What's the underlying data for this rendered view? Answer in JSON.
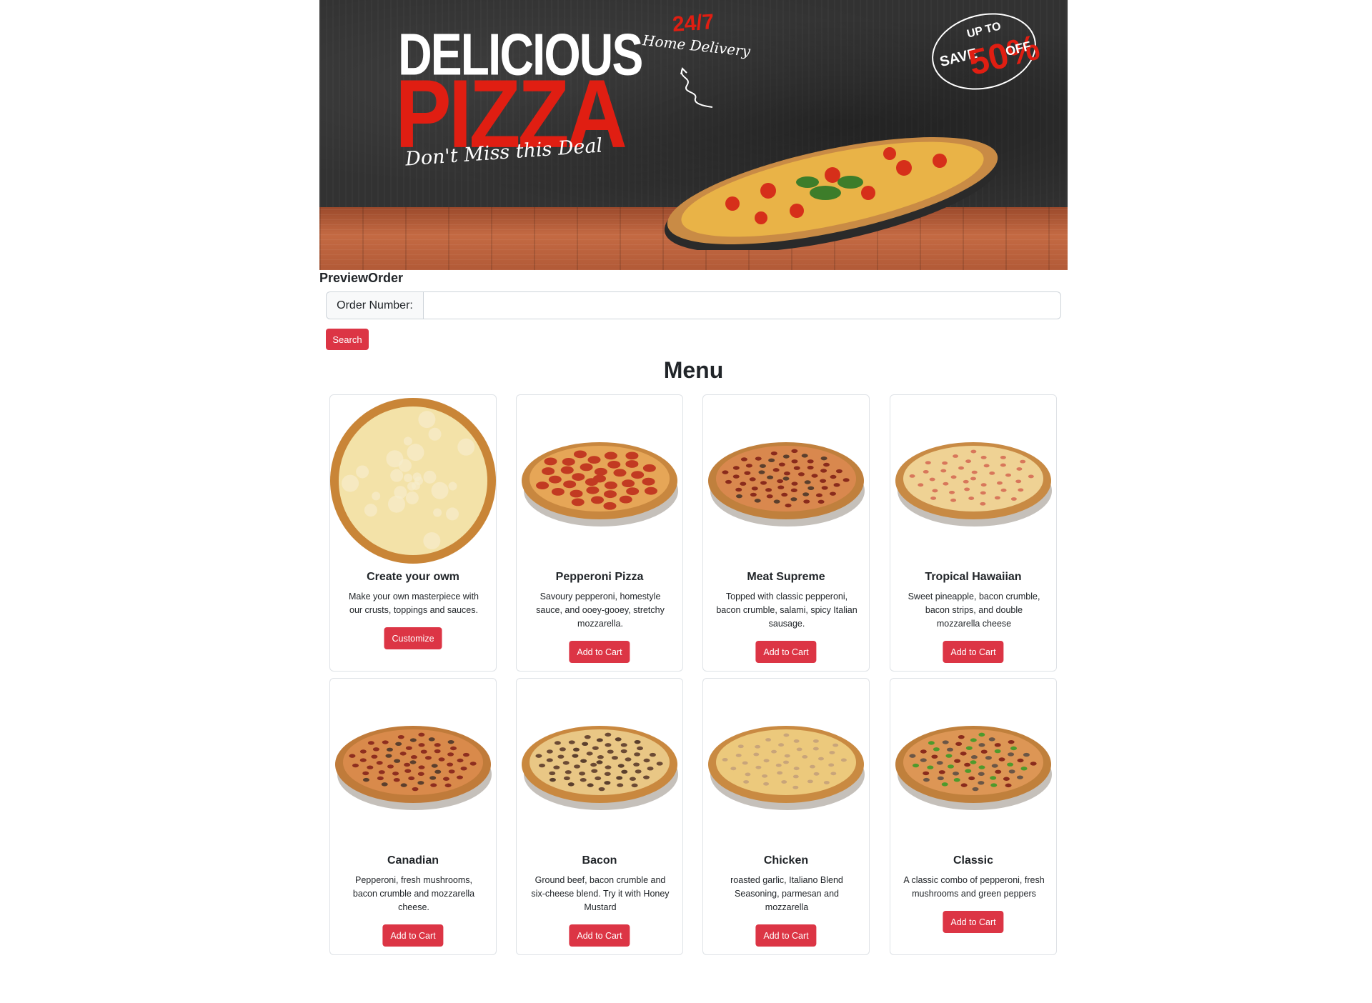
{
  "banner": {
    "headline_top": "DELICIOUS",
    "headline_main": "PIZZA",
    "tagline": "Don't Miss this Deal",
    "hours": "24/7",
    "delivery": "Home Delivery",
    "promo_upto": "UP TO",
    "promo_save": "SAVE",
    "promo_percent": "50%",
    "promo_off": "OFF"
  },
  "preview": {
    "title": "PreviewOrder",
    "order_label": "Order Number:",
    "order_value": "",
    "search_label": "Search"
  },
  "menu": {
    "title": "Menu",
    "items": [
      {
        "name": "Create your owm",
        "desc": "Make your own masterpiece with our crusts, toppings and sauces.",
        "button": "Customize",
        "style": "cheese"
      },
      {
        "name": "Pepperoni Pizza",
        "desc": "Savoury pepperoni, homestyle sauce, and ooey-gooey, stretchy mozzarella.",
        "button": "Add to Cart",
        "style": "pepperoni"
      },
      {
        "name": "Meat Supreme",
        "desc": "Topped with classic pepperoni, bacon crumble, salami, spicy Italian sausage.",
        "button": "Add to Cart",
        "style": "meat"
      },
      {
        "name": "Tropical Hawaiian",
        "desc": "Sweet pineapple, bacon crumble, bacon strips, and double mozzarella cheese",
        "button": "Add to Cart",
        "style": "hawaiian"
      },
      {
        "name": "Canadian",
        "desc": "Pepperoni, fresh mushrooms, bacon crumble and mozzarella cheese.",
        "button": "Add to Cart",
        "style": "canadian"
      },
      {
        "name": "Bacon",
        "desc": "Ground beef, bacon crumble and six-cheese blend. Try it with Honey Mustard",
        "button": "Add to Cart",
        "style": "bacon"
      },
      {
        "name": "Chicken",
        "desc": "roasted garlic, Italiano Blend Seasoning, parmesan and mozzarella",
        "button": "Add to Cart",
        "style": "chicken"
      },
      {
        "name": "Classic",
        "desc": "A classic combo of pepperoni, fresh mushrooms and green peppers",
        "button": "Add to Cart",
        "style": "classic"
      }
    ]
  },
  "colors": {
    "accent": "#dc3545",
    "banner_red": "#e01e12"
  }
}
